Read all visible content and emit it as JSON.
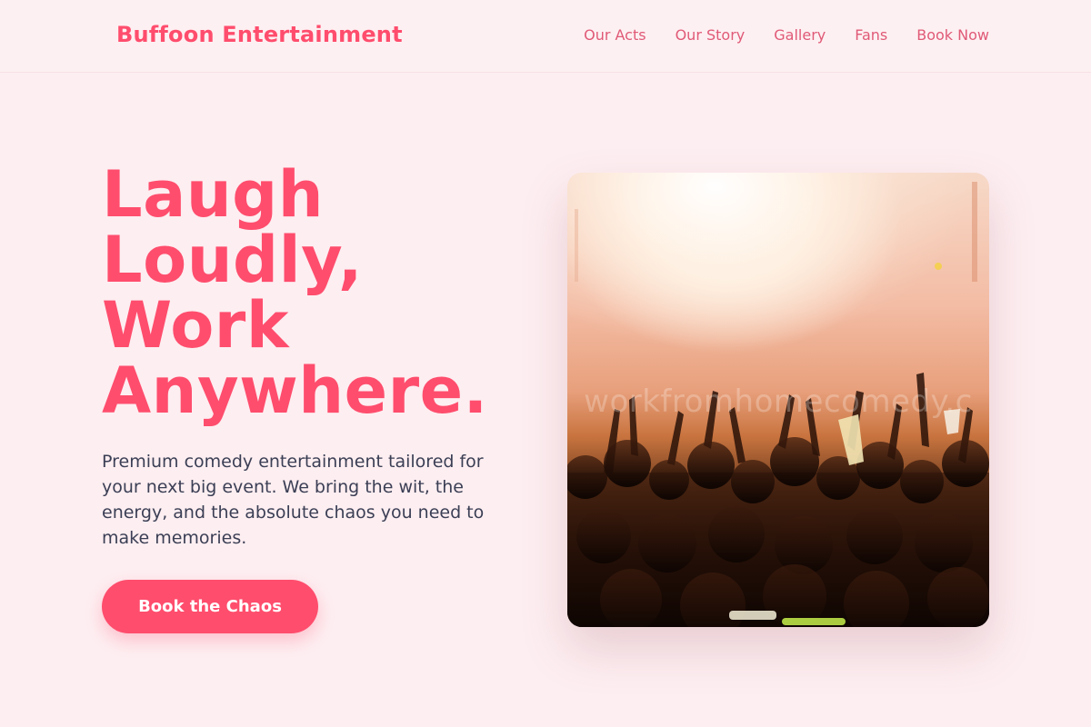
{
  "header": {
    "logo": "Buffoon Entertainment",
    "nav": [
      "Our Acts",
      "Our Story",
      "Gallery",
      "Fans",
      "Book Now"
    ]
  },
  "hero": {
    "title_lines": [
      "Laugh",
      "Loudly,",
      "Work",
      "Anywhere."
    ],
    "description": "Premium comedy entertainment tailored for your next big event. We bring the wit, the energy, and the absolute chaos you need to make memories.",
    "cta_label": "Book the Chaos",
    "image_watermark": "workfromhomecomedy.c"
  },
  "colors": {
    "background": "#fdeef1",
    "brand": "#ff4d6d",
    "nav_text": "#e05a77",
    "body_text": "#3b3f55"
  }
}
